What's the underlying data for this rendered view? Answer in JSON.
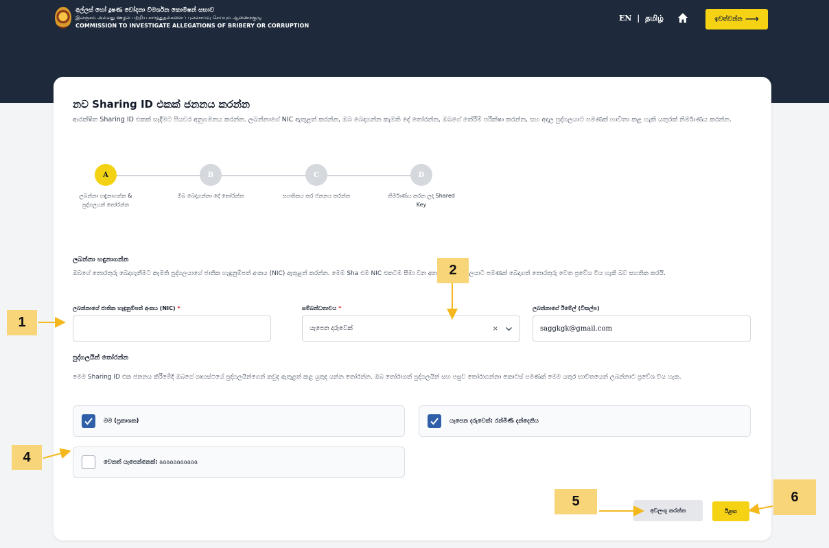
{
  "header": {
    "logo_line1": "අල්ලස් හෝ දූෂණ චෝදනා විමර්ශන කොමිෂන් සභාව",
    "logo_line2": "இலஞ்சம் அல்லது ஊழல் பற்றிய சார்த்துதல்களைப் புலனாய்வு செய்யும் ஆணைக்குழு",
    "logo_line3": "COMMISSION TO INVESTIGATE ALLEGATIONS OF BRIBERY OR CORRUPTION",
    "lang_en": "EN",
    "lang_sep": "|",
    "lang_ta": "தமிழ்",
    "logout_label": "ඉවත්වන්න",
    "logout_arrow": "⟶"
  },
  "page": {
    "title": "නව Sharing ID එකක් ජනනය කරන්න",
    "description": "ආරක්ෂිත Sharing ID එකක් සෑදීමට පියවර අනුගමනය කරන්න. ලබන්නාගේ NIC ඇතුළත් කරන්න, ඔබ බෙදාගන්න කැමති දේ තෝරන්න, ඔබගේ තේරීම් පරීක්ෂා කරන්න, සහ අදාල පුද්ගලයාට පමණක් භාවිතා කළ හැකි යතුරක් නිර්මාණය කරන්න."
  },
  "steps": [
    {
      "letter": "A",
      "label": "ලබන්නා හඳුනාගන්න & පුද්ගලයන් තෝරන්න"
    },
    {
      "letter": "B",
      "label": "ඔබ බෙදාගන්නා දේ තෝරන්න"
    },
    {
      "letter": "C",
      "label": "සහතිකය කර ජනනය කරන්න"
    },
    {
      "letter": "D",
      "label": "නිර්මාණය කරන ලද Shared Key"
    }
  ],
  "recipient": {
    "title": "ලබන්නා හඳුනාගන්න",
    "description": "ඔබගේ තොරතුරු බෙදාගැනීමට කැමති පුද්ගලයාගේ ජාතික හැඳුනුම්පත් අංකය (NIC) ඇතුළත් කරන්න. මෙම Sha                         එම NIC එකටම සීමා වන අතර, අදාළ පුද්ගලයාට පමණක් බෙදාගත් තොරතුරු වෙත ප්‍රවේශ විය හැකි බව සහතික කරයි.",
    "nic_label": "ලබන්නාගේ ජාතික හැඳුනුම්පත් අංකය (NIC)",
    "nic_value": "",
    "relationship_label": "සම්බන්ධතාවය",
    "relationship_value": "යැපෙන දරුවෙක්",
    "email_label": "ලබන්නාගේ ඊමේල් (විකල්ප)",
    "email_value": "saggkgk@gmail.com",
    "required_mark": "*"
  },
  "people": {
    "title": "පුද්ගලයින් තෝරන්න",
    "description": "මෙම Sharing ID එක ජනනය කිරීමේදී ඔබගේ ගෘහස්ථයේ පුද්ගලයින්ගෙන් කවුද ඇතුළත් කළ යුතුද යන්න තෝරන්න. ඔබ තෝරාගත් පුද්ගලයින් සහ පසුව තෝරාගන්නා කොටස් පමණක් මෙම යතුර භාවිතයෙන් ලබන්නාට ප්‍රවේශ විය හැක.",
    "options": [
      {
        "label": "මම (ප්‍රකාශක)",
        "name_text": "",
        "checked": true
      },
      {
        "label": "යැපෙන දරුවෙක්:",
        "name_text": " රන්මිණි දන්දෙනිය",
        "checked": true
      },
      {
        "label": "වෙනත් යැපෙන්නෙක්:",
        "name_text": " aaaaaaaaaaa",
        "checked": false
      }
    ]
  },
  "actions": {
    "cancel_label": "අවලංගු කරන්න",
    "next_label": "ඊළඟ"
  },
  "annotations": [
    "1",
    "2",
    "4",
    "5",
    "6"
  ],
  "colors": {
    "header_bg": "#1e2a3b",
    "accent_yellow": "#f6d214",
    "badge_yellow": "#f9d57a",
    "checkbox_blue": "#2f5fa8"
  }
}
